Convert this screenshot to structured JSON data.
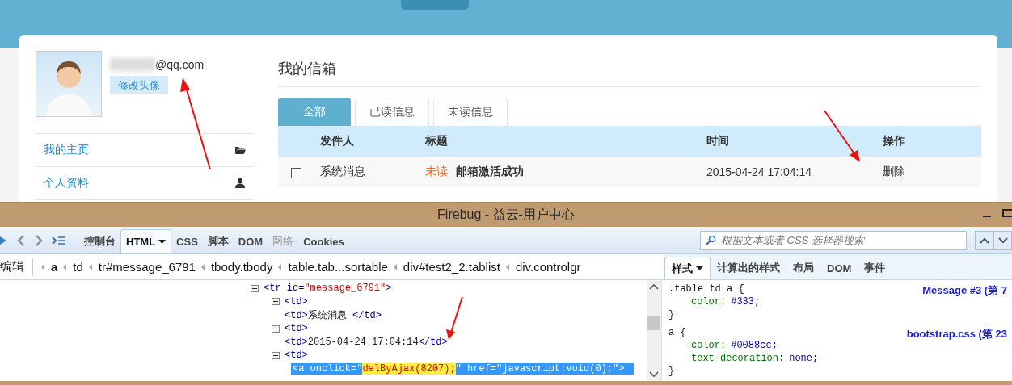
{
  "profile": {
    "email": "@qq.com",
    "change_avatar": "修改头像"
  },
  "sidebar": {
    "items": [
      {
        "label": "我的主页",
        "kind": "folder"
      },
      {
        "label": "个人资料",
        "kind": "user"
      }
    ]
  },
  "inbox": {
    "title": "我的信箱",
    "tabs": [
      {
        "label": "全部",
        "selected": true
      },
      {
        "label": "已读信息",
        "selected": false
      },
      {
        "label": "未读信息",
        "selected": false
      }
    ],
    "columns": [
      "发件人",
      "标题",
      "时间",
      "操作"
    ],
    "rows": [
      {
        "checked": false,
        "sender": "系统消息",
        "status": "未读",
        "subject": "邮箱激活成功",
        "time": "2015-04-24 17:04:14",
        "action": "删除"
      }
    ]
  },
  "firebug": {
    "title": "Firebug - 益云-用户中心",
    "tabs": [
      {
        "label": "控制台",
        "selected": false,
        "disabled": false,
        "dropdown": false
      },
      {
        "label": "HTML",
        "selected": true,
        "disabled": false,
        "dropdown": true
      },
      {
        "label": "CSS",
        "selected": false,
        "disabled": false,
        "dropdown": false
      },
      {
        "label": "脚本",
        "selected": false,
        "disabled": false,
        "dropdown": false
      },
      {
        "label": "DOM",
        "selected": false,
        "disabled": false,
        "dropdown": false
      },
      {
        "label": "网络",
        "selected": false,
        "disabled": true,
        "dropdown": false
      },
      {
        "label": "Cookies",
        "selected": false,
        "disabled": false,
        "dropdown": false
      }
    ],
    "search": {
      "placeholder": "根据文本或者 CSS 选择器搜索"
    },
    "edit_label": "编辑",
    "breadcrumbs": [
      {
        "label": "a",
        "selected": true
      },
      {
        "label": "td",
        "selected": false
      },
      {
        "label": "tr#message_6791",
        "selected": false
      },
      {
        "label": "tbody.tbody",
        "selected": false
      },
      {
        "label": "table.tab...sortable",
        "selected": false
      },
      {
        "label": "div#test2_2.tablist",
        "selected": false
      },
      {
        "label": "div.controlgr",
        "selected": false
      }
    ],
    "side_tabs": [
      {
        "label": "样式",
        "selected": true,
        "dropdown": true
      },
      {
        "label": "计算出的样式",
        "selected": false,
        "dropdown": false
      },
      {
        "label": "布局",
        "selected": false,
        "dropdown": false
      },
      {
        "label": "DOM",
        "selected": false,
        "dropdown": false
      },
      {
        "label": "事件",
        "selected": false,
        "dropdown": false
      }
    ],
    "html_tree": [
      {
        "expanded": true,
        "selected": false,
        "lines": [
          [
            {
              "kind": "tag",
              "text": "<tr id="
            },
            {
              "kind": "value",
              "text": "\"message_6791\""
            },
            {
              "kind": "tag",
              "text": ">"
            }
          ]
        ],
        "children": [
          {
            "expanded": false,
            "selected": false,
            "lines": [
              [
                {
                  "kind": "tag",
                  "text": "<td>"
                }
              ]
            ]
          },
          {
            "selected": false,
            "lines": [
              [
                {
                  "kind": "tag",
                  "text": "<td>"
                },
                {
                  "kind": "text",
                  "text": "系统消息 "
                },
                {
                  "kind": "tag",
                  "text": "</td>"
                }
              ]
            ]
          },
          {
            "expanded": false,
            "selected": false,
            "lines": [
              [
                {
                  "kind": "tag",
                  "text": "<td>"
                }
              ]
            ]
          },
          {
            "selected": false,
            "lines": [
              [
                {
                  "kind": "tag",
                  "text": "<td>"
                },
                {
                  "kind": "text",
                  "text": "2015-04-24 17:04:14"
                },
                {
                  "kind": "tag",
                  "text": "</td>"
                }
              ]
            ]
          },
          {
            "expanded": true,
            "selected": false,
            "lines": [
              [
                {
                  "kind": "tag",
                  "text": "<td>"
                }
              ]
            ],
            "children": [
              {
                "selected": true,
                "lines": [
                  [
                    {
                      "kind": "tag",
                      "text": "<a onclick=\""
                    },
                    {
                      "kind": "value",
                      "text": "delByAjax(8207);",
                      "highlighted": true
                    },
                    {
                      "kind": "tag",
                      "text": "\" href=\"javascript:void(0);\">"
                    }
                  ]
                ]
              }
            ]
          }
        ]
      }
    ],
    "css_rules": [
      {
        "selector": ".table td a {",
        "source": "Message #3 (第 7",
        "close": "}",
        "declarations": [
          {
            "property": "color:",
            "value": "#333;",
            "overridden": false
          }
        ]
      },
      {
        "selector": "a {",
        "source": "bootstrap.css (第 23",
        "close": "}",
        "declarations": [
          {
            "property": "color:",
            "value": "#0088cc;",
            "overridden": true
          },
          {
            "property": "text-decoration:",
            "value": "none;",
            "overridden": false
          }
        ]
      }
    ]
  }
}
